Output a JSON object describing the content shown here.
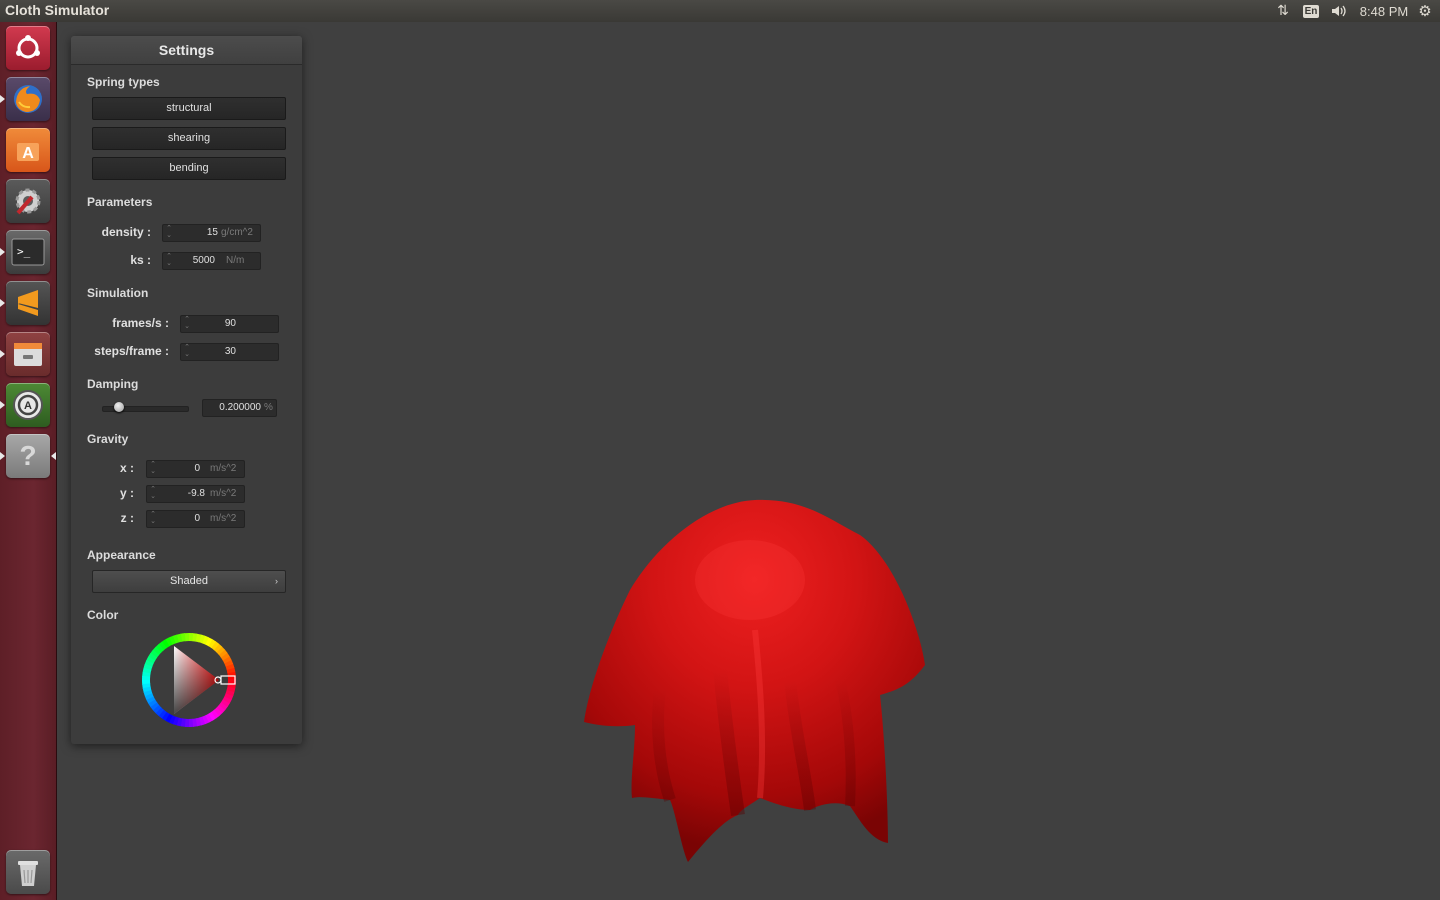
{
  "window": {
    "title": "Cloth Simulator"
  },
  "tray": {
    "language": "En",
    "time": "8:48 PM",
    "net_icon": "network-updown-icon",
    "volume_icon": "volume-icon",
    "session_icon": "gear-icon"
  },
  "launcher": {
    "items": [
      {
        "name": "ubuntu-dash-icon",
        "color": "#b7233a"
      },
      {
        "name": "firefox-icon",
        "color": "#e57a1f"
      },
      {
        "name": "software-center-icon",
        "color": "#e46a1e"
      },
      {
        "name": "system-settings-icon",
        "color": "#9c2b2e"
      },
      {
        "name": "terminal-icon",
        "color": "#2e2e2e"
      },
      {
        "name": "sublime-text-icon",
        "color": "#3d3d3d"
      },
      {
        "name": "files-icon",
        "color": "#8b3a3a"
      },
      {
        "name": "software-updater-icon",
        "color": "#3f6a2b"
      },
      {
        "name": "help-icon",
        "color": "#7f7f7f"
      },
      {
        "name": "trash-icon",
        "color": "#8a8a8a"
      }
    ]
  },
  "settings": {
    "title": "Settings",
    "spring_types": {
      "label": "Spring types",
      "buttons": [
        "structural",
        "shearing",
        "bending"
      ]
    },
    "parameters": {
      "label": "Parameters",
      "density": {
        "label": "density :",
        "value": "15",
        "unit": "g/cm^2"
      },
      "ks": {
        "label": "ks :",
        "value": "5000",
        "unit": "N/m"
      }
    },
    "simulation": {
      "label": "Simulation",
      "fps": {
        "label": "frames/s :",
        "value": "90"
      },
      "steps": {
        "label": "steps/frame :",
        "value": "30"
      }
    },
    "damping": {
      "label": "Damping",
      "value": "0.200000",
      "unit": "%",
      "slider_fraction": 0.2
    },
    "gravity": {
      "label": "Gravity",
      "x": {
        "label": "x :",
        "value": "0",
        "unit": "m/s^2"
      },
      "y": {
        "label": "y :",
        "value": "-9.8",
        "unit": "m/s^2"
      },
      "z": {
        "label": "z :",
        "value": "0",
        "unit": "m/s^2"
      }
    },
    "appearance": {
      "label": "Appearance",
      "selected": "Shaded"
    },
    "color": {
      "label": "Color",
      "value": "#e01010"
    }
  }
}
